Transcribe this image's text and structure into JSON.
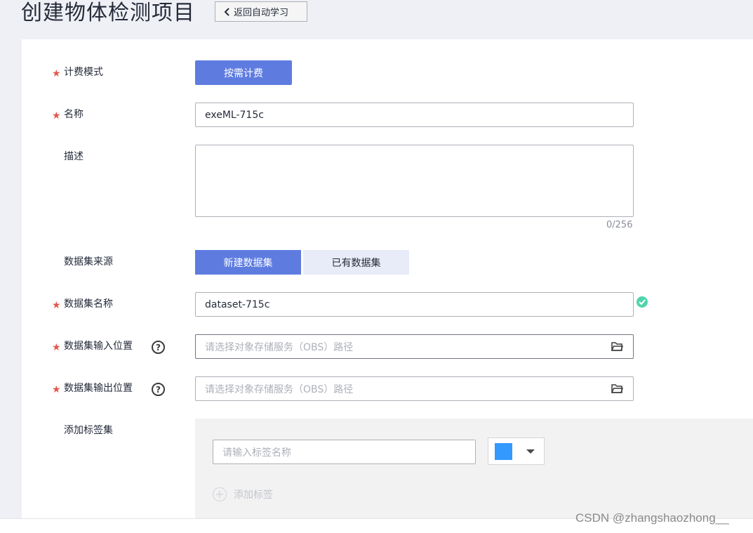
{
  "header": {
    "title": "创建物体检测项目",
    "back_label": "返回自动学习"
  },
  "form": {
    "billing": {
      "label": "计费模式",
      "required_mark": "★",
      "value": "按需计费"
    },
    "name": {
      "label": "名称",
      "required_mark": "★",
      "value": "exeML-715c"
    },
    "description": {
      "label": "描述",
      "value": "",
      "counter": "0/256"
    },
    "dataset_source": {
      "label": "数据集来源",
      "options": [
        "新建数据集",
        "已有数据集"
      ],
      "selected": "新建数据集"
    },
    "dataset_name": {
      "label": "数据集名称",
      "required_mark": "★",
      "value": "dataset-715c"
    },
    "dataset_input": {
      "label": "数据集输入位置",
      "required_mark": "★",
      "help": "?",
      "placeholder": "请选择对象存储服务（OBS）路径"
    },
    "dataset_output": {
      "label": "数据集输出位置",
      "required_mark": "★",
      "help": "?",
      "placeholder": "请选择对象存储服务（OBS）路径"
    },
    "tag_set": {
      "label": "添加标签集",
      "tag_name_placeholder": "请输入标签名称",
      "tag_color": "#3399ff",
      "add_tag_label": "添加标签",
      "add_icon": "+"
    }
  },
  "watermark": "CSDN @zhangshaozhong__",
  "colors": {
    "primary": "#5e7ce0",
    "required": "#e5554a",
    "success": "#50d4ab"
  }
}
